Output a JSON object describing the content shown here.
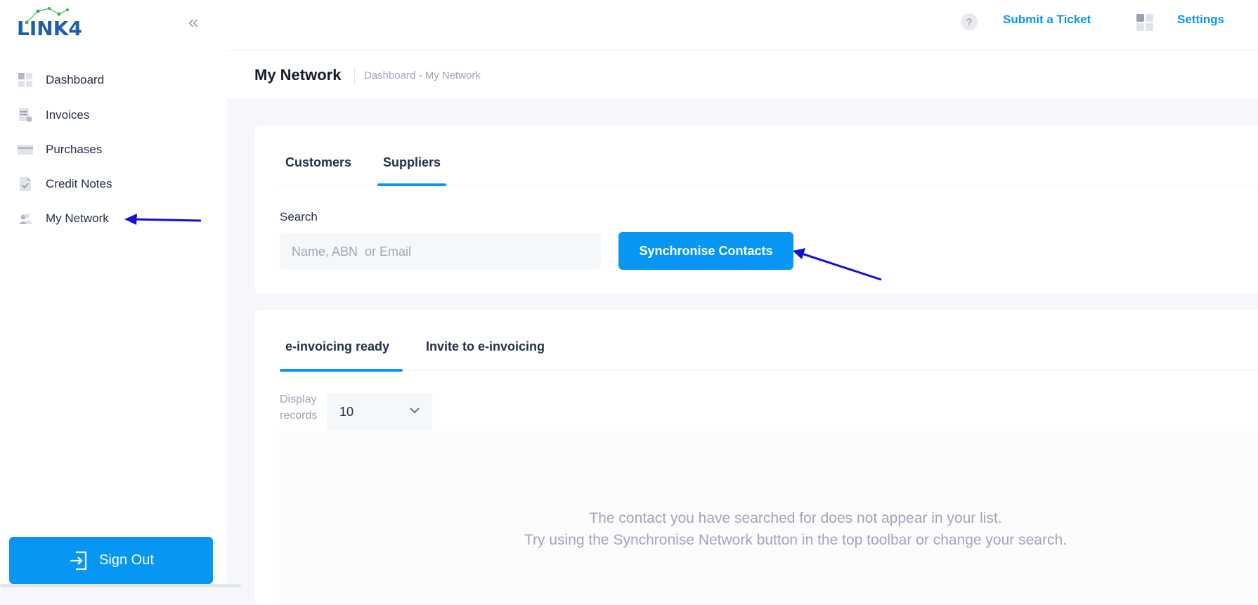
{
  "brand": {
    "logo_text": "LINK4"
  },
  "sidebar": {
    "items": [
      {
        "label": "Dashboard",
        "icon": "dashboard-icon"
      },
      {
        "label": "Invoices",
        "icon": "invoice-icon"
      },
      {
        "label": "Purchases",
        "icon": "card-icon"
      },
      {
        "label": "Credit Notes",
        "icon": "document-check-icon"
      },
      {
        "label": "My Network",
        "icon": "users-icon"
      }
    ],
    "sign_out": "Sign Out"
  },
  "header": {
    "help": "?",
    "submit_ticket": "Submit a Ticket",
    "settings": "Settings"
  },
  "page": {
    "title": "My Network",
    "breadcrumb": "Dashboard - My Network"
  },
  "top_tabs": {
    "customers": "Customers",
    "suppliers": "Suppliers"
  },
  "search": {
    "label": "Search",
    "placeholder": "Name, ABN  or Email",
    "value": ""
  },
  "sync_button": "Synchronise Contacts",
  "list_tabs": {
    "ready": "e-invoicing ready",
    "invite": "Invite to e-invoicing"
  },
  "records": {
    "label": "Display records",
    "value": "10"
  },
  "empty": {
    "line1": "The contact you have searched for does not appear in your list.",
    "line2": "Try using the Synchronise Network button in the top toolbar or change your search."
  },
  "colors": {
    "accent": "#0797f3",
    "logo": "#1f5fa8",
    "annotation": "#1010d8"
  }
}
